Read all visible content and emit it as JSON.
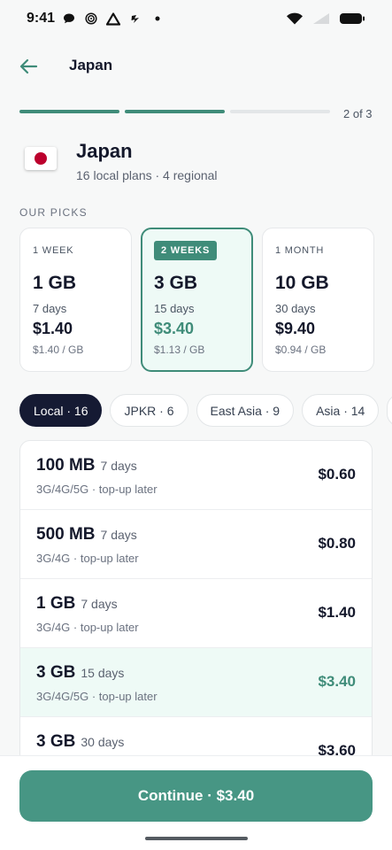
{
  "status_bar": {
    "time": "9:41",
    "left_icons": [
      "chat-bubble-icon",
      "target-icon",
      "triangle-icon",
      "bolt-icon",
      "dot-icon"
    ],
    "right_icons": [
      "wifi-icon",
      "signal-icon",
      "battery-icon"
    ]
  },
  "header": {
    "back_icon": "arrow-left-icon",
    "title": "Japan"
  },
  "progress": {
    "total_steps": 3,
    "current_step": 2,
    "label": "2 of 3"
  },
  "country": {
    "flag": "japan-flag",
    "name": "Japan",
    "subtitle": "16 local plans · 4 regional"
  },
  "picks": {
    "section_label": "OUR PICKS",
    "cards": [
      {
        "label": "1 WEEK",
        "data": "1 GB",
        "days": "7 days",
        "price": "$1.40",
        "unit_price": "$1.40 / GB",
        "selected": false
      },
      {
        "label": "2 WEEKS",
        "data": "3 GB",
        "days": "15 days",
        "price": "$3.40",
        "unit_price": "$1.13 / GB",
        "selected": true
      },
      {
        "label": "1 MONTH",
        "data": "10 GB",
        "days": "30 days",
        "price": "$9.40",
        "unit_price": "$0.94 / GB",
        "selected": false
      }
    ]
  },
  "filters": [
    {
      "label": "Local · 16",
      "active": true
    },
    {
      "label": "JPKR · 6",
      "active": false
    },
    {
      "label": "East Asia · 9",
      "active": false
    },
    {
      "label": "Asia · 14",
      "active": false
    },
    {
      "label": "",
      "active": false
    }
  ],
  "plans": [
    {
      "data": "100 MB",
      "days": "7 days",
      "network": "3G/4G/5G · top-up later",
      "price": "$0.60",
      "selected": false
    },
    {
      "data": "500 MB",
      "days": "7 days",
      "network": "3G/4G · top-up later",
      "price": "$0.80",
      "selected": false
    },
    {
      "data": "1 GB",
      "days": "7 days",
      "network": "3G/4G · top-up later",
      "price": "$1.40",
      "selected": false
    },
    {
      "data": "3 GB",
      "days": "15 days",
      "network": "3G/4G/5G · top-up later",
      "price": "$3.40",
      "selected": true
    },
    {
      "data": "3 GB",
      "days": "30 days",
      "network": "",
      "price": "$3.60",
      "selected": false
    }
  ],
  "footer": {
    "continue_label": "Continue · $3.40"
  },
  "colors": {
    "accent": "#3f8c79",
    "button": "#479684",
    "active_chip": "#151a33",
    "selected_bg": "#eefaf6"
  }
}
